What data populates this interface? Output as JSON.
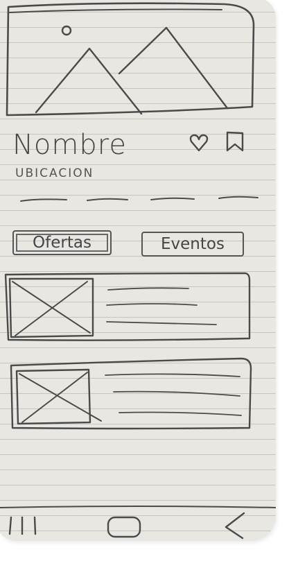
{
  "place": {
    "name": "Nombre",
    "location": "Ubicacion"
  },
  "icons": {
    "hero_image": "image-placeholder-icon",
    "favorite": "heart-icon",
    "bookmark": "bookmark-icon"
  },
  "tabs": [
    {
      "label": "Ofertas",
      "selected": true
    },
    {
      "label": "Eventos",
      "selected": false
    }
  ],
  "list": {
    "items": [
      {
        "thumbnail": "image-placeholder-icon",
        "text_lines": 3
      },
      {
        "thumbnail": "image-placeholder-icon",
        "text_lines": 3
      }
    ]
  },
  "nav_bar": {
    "recents": "recents-icon",
    "home": "home-icon",
    "back": "back-icon"
  },
  "colors": {
    "paper": "#e9e7e2",
    "ruled_line": "#b8c6dc",
    "ink": "#4a4a4a"
  }
}
